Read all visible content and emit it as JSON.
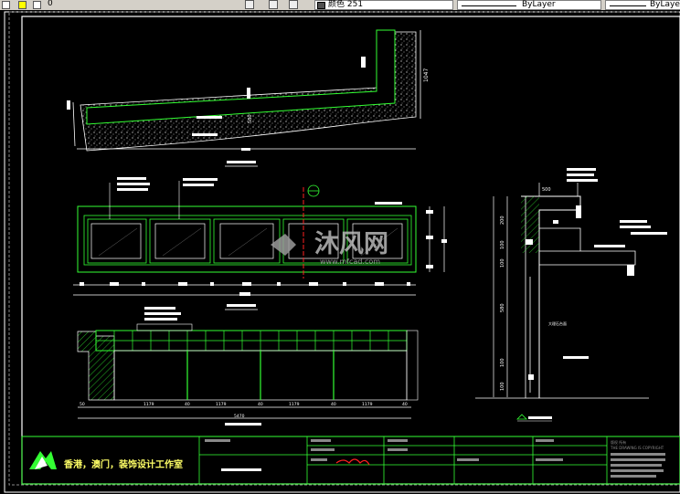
{
  "toolbar": {
    "layer_value": "0",
    "color_label": "颜色 251",
    "linetype_label": "ByLayer",
    "lineweight_label": "ByLayer"
  },
  "drawing": {
    "dims": {
      "plan_side": "1047",
      "plan_inner": "580",
      "section_top": "500",
      "section_200": "200",
      "section_100a": "100",
      "section_100b": "100",
      "section_580": "580",
      "section_100c": "100",
      "section_100d": "100",
      "bottom": [
        "50",
        "1179",
        "40",
        "1179",
        "40",
        "1179",
        "40",
        "1179",
        "40"
      ],
      "bottom_total": "5470"
    },
    "section_note": "大理石台面",
    "watermark_text": "沐风网",
    "watermark_url": "www.mfcad.com"
  },
  "title_block": {
    "company": "香港，澳门，装饰设计工作室",
    "copyright_line1": "版权 所有",
    "copyright_line2": "THE DRAWING IS COPYRIGHT"
  },
  "colors": {
    "green": "#33ff33",
    "white": "#ffffff",
    "red": "#ff2020",
    "gray": "#c0c0c0"
  }
}
